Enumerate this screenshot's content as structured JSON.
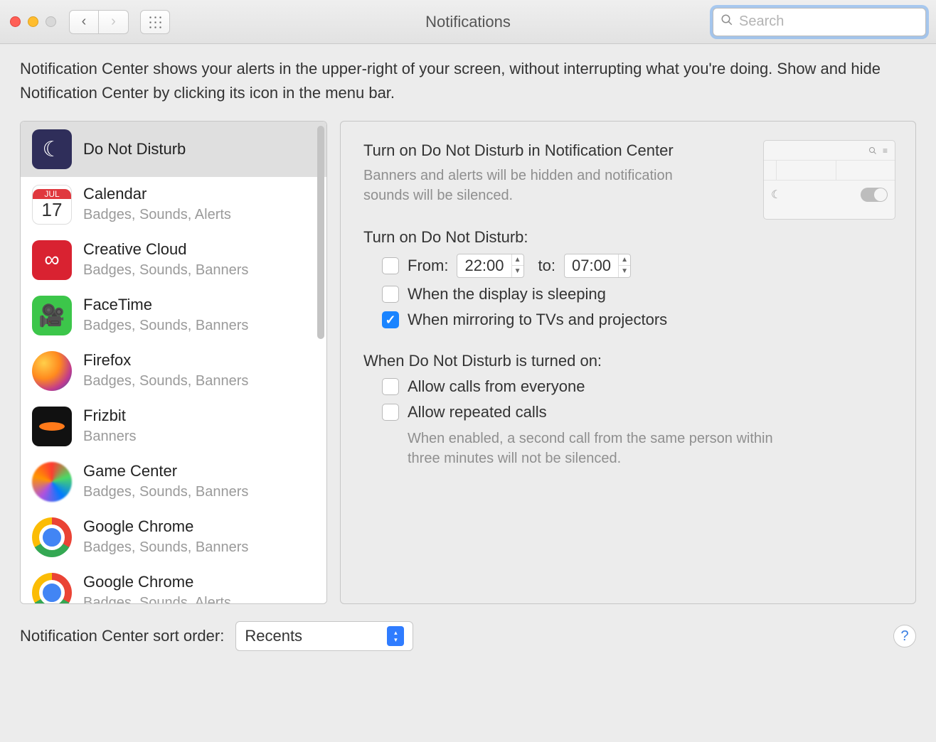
{
  "window": {
    "title": "Notifications"
  },
  "search": {
    "placeholder": "Search"
  },
  "description": "Notification Center shows your alerts in the upper-right of your screen, without interrupting what you're doing. Show and hide Notification Center by clicking its icon in the menu bar.",
  "sidebar": {
    "items": [
      {
        "name": "Do Not Disturb",
        "subtitle": "",
        "icon": "i-dnd",
        "glyph": "☾",
        "selected": true
      },
      {
        "name": "Calendar",
        "subtitle": "Badges, Sounds, Alerts",
        "icon": "i-cal",
        "glyph": "",
        "selected": false
      },
      {
        "name": "Creative Cloud",
        "subtitle": "Badges, Sounds, Banners",
        "icon": "i-cc",
        "glyph": "∞",
        "selected": false
      },
      {
        "name": "FaceTime",
        "subtitle": "Badges, Sounds, Banners",
        "icon": "i-ft",
        "glyph": "🎥",
        "selected": false
      },
      {
        "name": "Firefox",
        "subtitle": "Badges, Sounds, Banners",
        "icon": "i-fx",
        "glyph": "",
        "selected": false
      },
      {
        "name": "Frizbit",
        "subtitle": "Banners",
        "icon": "i-fz",
        "glyph": "",
        "selected": false
      },
      {
        "name": "Game Center",
        "subtitle": "Badges, Sounds, Banners",
        "icon": "i-gc",
        "glyph": "",
        "selected": false
      },
      {
        "name": "Google Chrome",
        "subtitle": "Badges, Sounds, Banners",
        "icon": "i-ch",
        "glyph": "",
        "selected": false
      },
      {
        "name": "Google Chrome",
        "subtitle": "Badges, Sounds, Alerts",
        "icon": "i-ch",
        "glyph": "",
        "selected": false
      }
    ]
  },
  "detail": {
    "heading": "Turn on Do Not Disturb in Notification Center",
    "subheading": "Banners and alerts will be hidden and notification sounds will be silenced.",
    "schedule_label": "Turn on Do Not Disturb:",
    "from_label": "From:",
    "to_label": "to:",
    "from_time": "22:00",
    "to_time": "07:00",
    "options": [
      {
        "label": "When the display is sleeping",
        "checked": false
      },
      {
        "label": "When mirroring to TVs and projectors",
        "checked": true
      }
    ],
    "turned_on_label": "When Do Not Disturb is turned on:",
    "turned_on_options": [
      {
        "label": "Allow calls from everyone",
        "checked": false
      },
      {
        "label": "Allow repeated calls",
        "checked": false
      }
    ],
    "repeated_note": "When enabled, a second call from the same person within three minutes will not be silenced."
  },
  "footer": {
    "sort_label": "Notification Center sort order:",
    "sort_value": "Recents"
  },
  "calendar_preview": {
    "month": "JUL",
    "day": "17"
  }
}
